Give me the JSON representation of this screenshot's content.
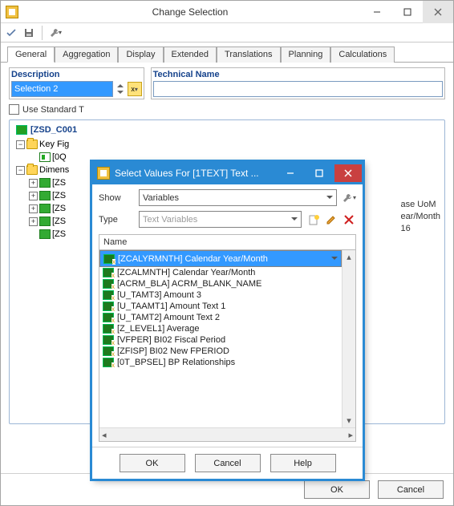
{
  "outer": {
    "title": "Change Selection"
  },
  "toolbar": {
    "check": "✔",
    "save": "💾",
    "magic": "🔧"
  },
  "tabs": [
    "General",
    "Aggregation",
    "Display",
    "Extended",
    "Translations",
    "Planning",
    "Calculations"
  ],
  "description": {
    "label": "Description",
    "value": "Selection 2"
  },
  "techname": {
    "label": "Technical Name",
    "value": ""
  },
  "use_std_label": "Use Standard T",
  "group_title": "[ZSD_C001",
  "tree": {
    "key_figures": "Key Fig",
    "kf_item": "[0Q",
    "dimensions": "Dimens",
    "dim_items": [
      "[ZS",
      "[ZS",
      "[ZS",
      "[ZS",
      "[ZS"
    ]
  },
  "partial": {
    "l1": "ase UoM",
    "l2": "ear/Month",
    "l3": "16"
  },
  "modal": {
    "title": "Select Values For [1TEXT] Text ...",
    "show_label": "Show",
    "show_value": "Variables",
    "type_label": "Type",
    "type_value": "Text Variables",
    "name_header": "Name",
    "items": [
      "[ZCALYRMNTH] Calendar Year/Month",
      "[ZCALMNTH] Calendar Year/Month",
      "[ACRM_BLA] ACRM_BLANK_NAME",
      "[U_TAMT3] Amount 3",
      "[U_TAAMT1] Amount Text 1",
      "[U_TAMT2] Amount Text 2",
      "[Z_LEVEL1] Average",
      "[VFPER] BI02 Fiscal Period",
      "[ZFISP] BI02 New FPERIOD",
      "[0T_BPSEL] BP Relationships"
    ],
    "ok": "OK",
    "cancel": "Cancel",
    "help": "Help"
  },
  "footer": {
    "ok": "OK",
    "cancel": "Cancel"
  }
}
